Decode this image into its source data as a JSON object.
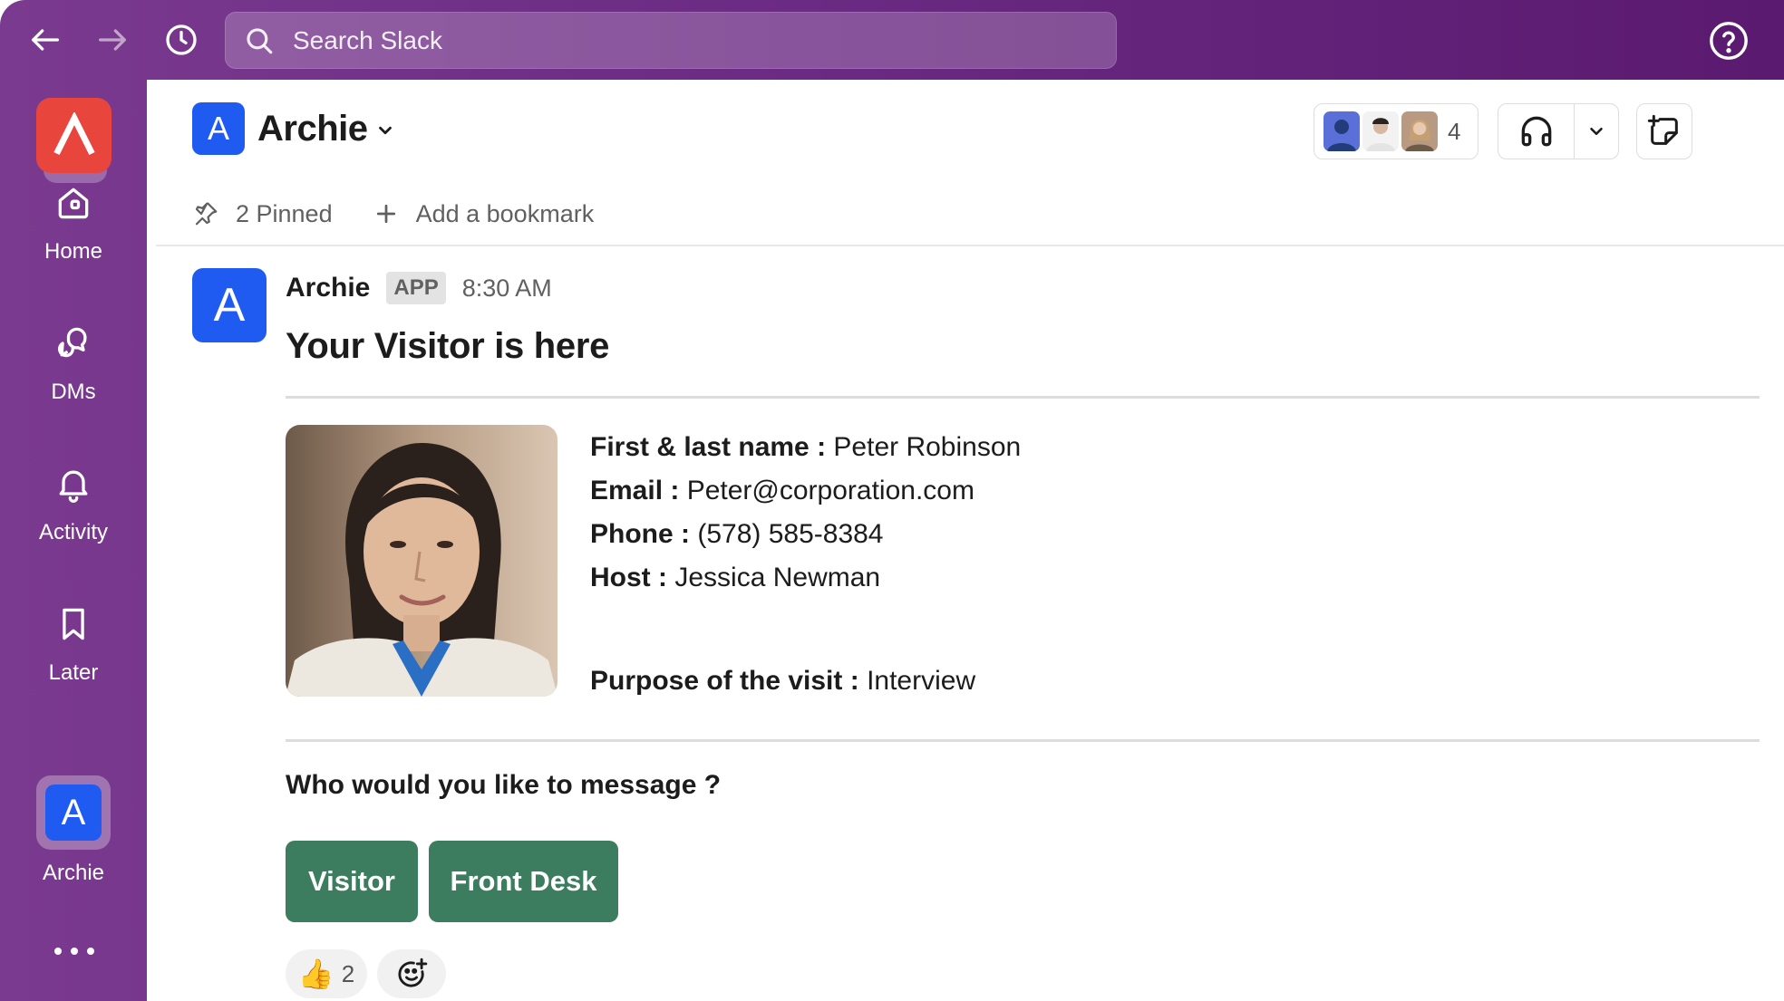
{
  "topbar": {
    "search_placeholder": "Search Slack"
  },
  "rail": {
    "items": [
      {
        "label": "Home",
        "icon": "home-icon"
      },
      {
        "label": "DMs",
        "icon": "dms-icon"
      },
      {
        "label": "Activity",
        "icon": "bell-icon"
      },
      {
        "label": "Later",
        "icon": "bookmark-icon"
      },
      {
        "label": "Archie",
        "icon": "archie-app-icon",
        "initial": "A"
      }
    ]
  },
  "channel": {
    "avatar_initial": "A",
    "name": "Archie",
    "member_count": "4"
  },
  "bookmarks": {
    "pinned": "2 Pinned",
    "add": "Add a bookmark"
  },
  "message": {
    "avatar_initial": "A",
    "sender": "Archie",
    "badge": "APP",
    "time": "8:30 AM",
    "title": "Your Visitor is here",
    "fields": [
      {
        "label": "First & last name :",
        "value": "Peter Robinson"
      },
      {
        "label": "Email :",
        "value": "Peter@corporation.com"
      },
      {
        "label": "Phone :",
        "value": "(578) 585-8384"
      },
      {
        "label": "Host :",
        "value": "Jessica Newman"
      },
      {
        "label": "Purpose of the visit :",
        "value": "Interview"
      }
    ],
    "question": "Who would you like to message ?",
    "buttons": [
      "Visitor",
      "Front Desk"
    ],
    "reactions": [
      {
        "emoji": "👍",
        "count": "2"
      }
    ]
  },
  "colors": {
    "sidebar": "#6b2a83",
    "brand_red": "#e8453c",
    "archie_blue": "#1f5bf0",
    "button_green": "#3b7d5e"
  }
}
